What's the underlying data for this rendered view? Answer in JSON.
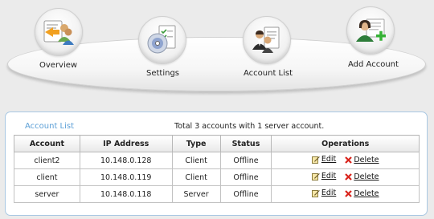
{
  "nav": {
    "overview": "Overview",
    "settings": "Settings",
    "account_list": "Account List",
    "add_account": "Add Account"
  },
  "panel": {
    "title": "Account List",
    "summary": "Total 3 accounts with 1 server account."
  },
  "table": {
    "headers": {
      "account": "Account",
      "ip": "IP Address",
      "type": "Type",
      "status": "Status",
      "operations": "Operations"
    },
    "rows": [
      {
        "account": "client2",
        "ip": "10.148.0.128",
        "type": "Client",
        "status": "Offline",
        "edit": "Edit",
        "delete": "Delete"
      },
      {
        "account": "client",
        "ip": "10.148.0.119",
        "type": "Client",
        "status": "Offline",
        "edit": "Edit",
        "delete": "Delete"
      },
      {
        "account": "server",
        "ip": "10.148.0.118",
        "type": "Server",
        "status": "Offline",
        "edit": "Edit",
        "delete": "Delete"
      }
    ]
  },
  "colors": {
    "panel_border": "#a9c8e3",
    "title_blue": "#5b9fd6",
    "delete_red": "#d9251d"
  },
  "icons": {
    "overview": "overview-users-folder-icon",
    "settings": "settings-disc-checklist-icon",
    "account_list": "account-list-users-document-icon",
    "add_account": "add-account-user-plus-icon",
    "edit": "edit-icon",
    "delete": "delete-icon"
  }
}
